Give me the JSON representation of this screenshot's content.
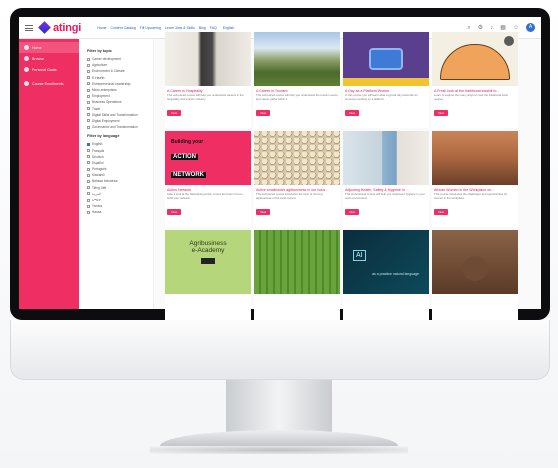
{
  "app": {
    "logo_text": "atingi"
  },
  "topnav": {
    "links": [
      "Home",
      "Content Catalog",
      "Fill Upcoming",
      "Learn Jobs & Skills",
      "Blog",
      "FAQ"
    ],
    "language": "English"
  },
  "header_icons": [
    "search-icon",
    "settings-icon",
    "bell-icon",
    "grid-icon",
    "user-icon"
  ],
  "avatar_initial": "A",
  "sidebar": {
    "items": [
      {
        "label": "Home",
        "icon": "home-icon",
        "active": true
      },
      {
        "label": "Browse",
        "icon": "compass-icon",
        "active": false
      },
      {
        "label": "Personal Goals",
        "icon": "target-icon",
        "active": false
      },
      {
        "label": "Course Enrollments",
        "icon": "book-icon",
        "active": false
      }
    ]
  },
  "filters": {
    "topic_heading": "Filter by topic",
    "topics": [
      "Career development",
      "Agriculture",
      "Environment & Climate",
      "E-Health",
      "Entrepreneurial Leadership",
      "Micro-enterprises",
      "Employment",
      "Business Operations",
      "Trade",
      "Digital Skills and Transformation",
      "Digital Employment",
      "Governance and Transformation"
    ],
    "language_heading": "Filter by language",
    "languages": [
      {
        "label": "English",
        "checked": true
      },
      {
        "label": "Français",
        "checked": false
      },
      {
        "label": "Deutsch",
        "checked": false
      },
      {
        "label": "Español",
        "checked": false
      },
      {
        "label": "Português",
        "checked": false
      },
      {
        "label": "Kiswahili",
        "checked": false
      },
      {
        "label": "Bahasa Indonesia",
        "checked": false
      },
      {
        "label": "Tiếng Việt",
        "checked": false
      },
      {
        "label": "العربية",
        "checked": false
      },
      {
        "label": "አማርኛ",
        "checked": false
      },
      {
        "label": "Yoruba",
        "checked": false
      },
      {
        "label": "Hausa",
        "checked": false
      }
    ]
  },
  "cards": [
    {
      "title": "A Career in Hospitality",
      "desc": "This self-paced course will help you understand careers in the hospitality and tourism industry.",
      "button": "View"
    },
    {
      "title": "A Career in Tourism",
      "desc": "This self-paced course will help you understand the tourism sector and career paths within it.",
      "button": "View"
    },
    {
      "title": "A Day as a Platform Worker",
      "desc": "In this course you will learn what a typical day looks like for someone working on a platform.",
      "button": "View"
    },
    {
      "title": "A Fresh look at the traditional swahili fo...",
      "desc": "Learn to explore the many ways to cook the traditional local recipes.",
      "button": "View"
    },
    {
      "title": "Action Network",
      "desc": "Take a look at the Networking Action course and learn how to build your network.",
      "button": "View"
    },
    {
      "title": "Active smallholder agribusiness in our hous...",
      "desc": "This self-paced course introduces the topic of forming agribusiness in the local context.",
      "button": "View"
    },
    {
      "title": "Adjusting Health, Safety & Hygiene in ...",
      "desc": "This professional course will help you implement hygiene in your work environment.",
      "button": "View"
    },
    {
      "title": "African Women in the Workplace on...",
      "desc": "This course introduces the challenges and opportunities for women in the workplace.",
      "button": "View"
    },
    {
      "title": "Agribusiness e-Academy",
      "desc": "",
      "button": ""
    },
    {
      "title": "",
      "desc": "",
      "button": ""
    },
    {
      "title": "",
      "desc": "",
      "button": ""
    },
    {
      "title": "",
      "desc": "",
      "button": ""
    }
  ],
  "thumb_text": {
    "action_l1": "Building your",
    "action_l2": "ACTION",
    "action_l3": "NETWORK",
    "agri_l1": "Agribusiness",
    "agri_l2": "e-Academy",
    "ai_badge": "AI",
    "ai_caption": "as a practice natural language"
  },
  "colors": {
    "brand": "#ef2e63",
    "accent_blue": "#2f6fd6"
  }
}
